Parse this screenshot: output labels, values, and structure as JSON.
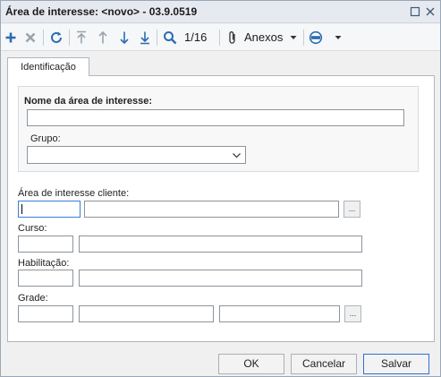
{
  "window": {
    "title": "Área de interesse: <novo> - 03.9.0519"
  },
  "titlebar_icons": [
    "restore-icon",
    "close-icon"
  ],
  "toolbar": {
    "record_position": "1/16",
    "attachments_label": "Anexos",
    "icons": [
      "plus-icon",
      "delete-icon",
      "refresh-icon",
      "first-icon",
      "previous-icon",
      "next-icon",
      "last-icon",
      "search-icon",
      "paperclip-icon",
      "chevron-down-icon",
      "workflow-icon",
      "chevron-down-icon"
    ]
  },
  "tabs": [
    {
      "label": "Identificação",
      "active": true
    }
  ],
  "form": {
    "name_label": "Nome da área de interesse:",
    "name_value": "",
    "group_label": "Grupo:",
    "group_value": "",
    "client_area_label": "Área de interesse cliente:",
    "client_area_code": "",
    "client_area_desc": "",
    "course_label": "Curso:",
    "course_code": "",
    "course_desc": "",
    "qualification_label": "Habilitação:",
    "qualification_code": "",
    "qualification_desc": "",
    "grade_label": "Grade:",
    "grade_code": "",
    "grade_field2": "",
    "grade_field3": "",
    "lookup_label": "..."
  },
  "buttons": {
    "ok": "OK",
    "cancel": "Cancelar",
    "save": "Salvar"
  },
  "colors": {
    "accent_blue": "#2b6cb0",
    "disabled_gray": "#9aa3ad",
    "focus_border": "#3b7dd8",
    "save_border": "#2f6fd6"
  }
}
